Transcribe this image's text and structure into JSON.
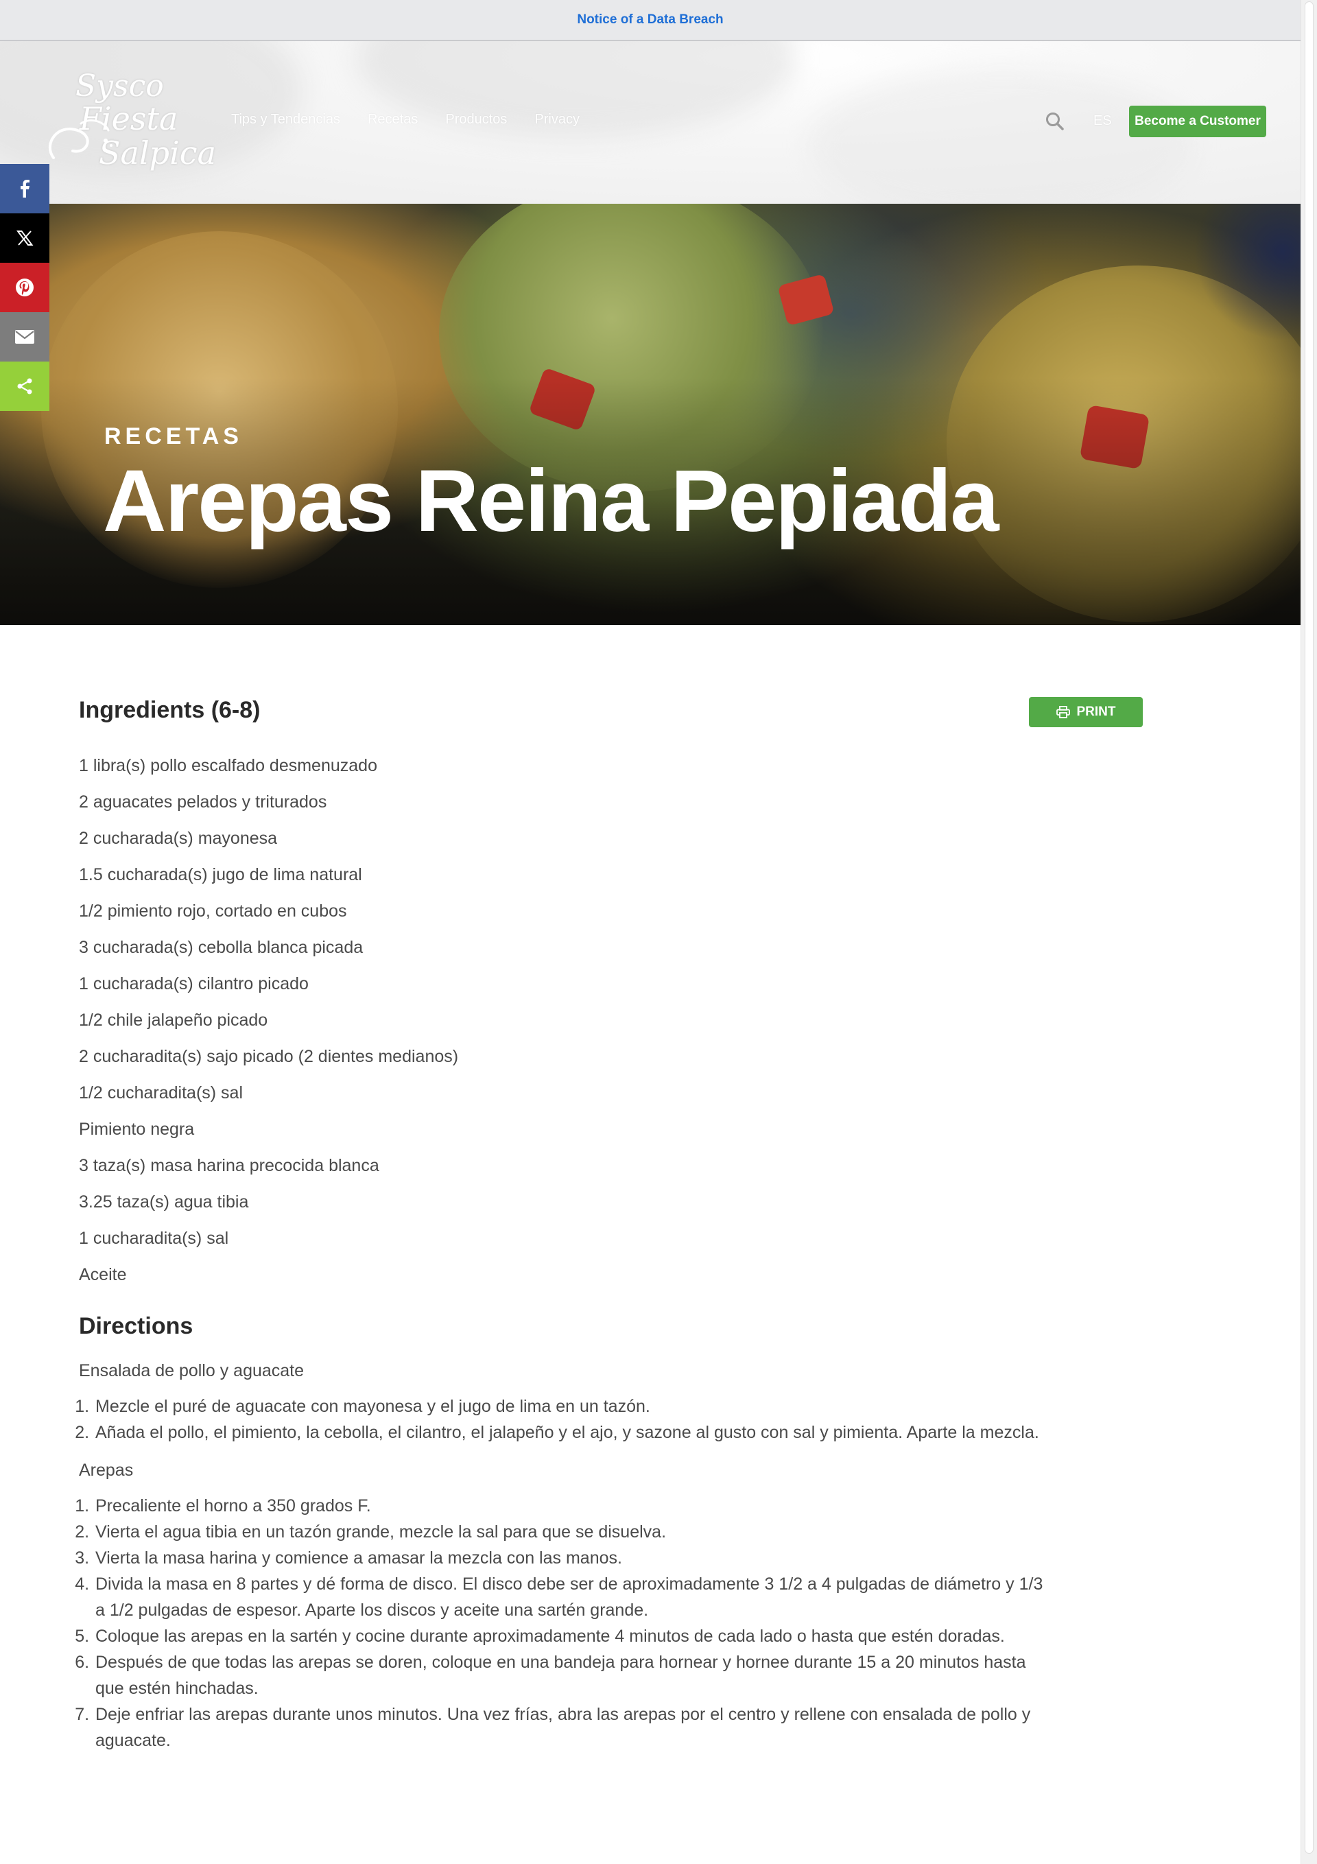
{
  "notice": {
    "link_label": "Notice of a Data Breach"
  },
  "brand": {
    "logo_line1": "Sysco",
    "logo_line2": "Fiesta",
    "logo_line3": "Salpica",
    "accent_color": "#53aa47",
    "link_color": "#1f6fd6"
  },
  "nav": {
    "items": [
      {
        "label": "Tips y Tendencias"
      },
      {
        "label": "Recetas"
      },
      {
        "label": "Productos"
      },
      {
        "label": "Privacy"
      }
    ],
    "search_icon": "search-icon",
    "language": "ES",
    "cta_label": "Become a Customer"
  },
  "share": {
    "buttons": [
      {
        "icon": "facebook-icon",
        "color": "#3b5998"
      },
      {
        "icon": "x-icon",
        "color": "#000000"
      },
      {
        "icon": "pinterest-icon",
        "color": "#cb2027"
      },
      {
        "icon": "email-icon",
        "color": "#7d7d7d"
      },
      {
        "icon": "share-icon",
        "color": "#95d03a"
      }
    ]
  },
  "hero": {
    "kicker": "RECETAS",
    "title": "Arepas Reina Pepiada"
  },
  "recipe": {
    "ingredients_title": "Ingredients (6-8)",
    "print_label": "PRINT",
    "ingredients": [
      "1 libra(s) pollo escalfado desmenuzado",
      "2 aguacates pelados y triturados",
      "2 cucharada(s) mayonesa",
      "1.5 cucharada(s) jugo de lima natural",
      "1/2 pimiento rojo, cortado en cubos",
      "3 cucharada(s) cebolla blanca picada",
      "1 cucharada(s) cilantro picado",
      "1/2 chile jalapeño picado",
      "2 cucharadita(s) sajo picado (2 dientes medianos)",
      "1/2 cucharadita(s) sal",
      "Pimiento negra",
      "3 taza(s) masa harina precocida blanca",
      "3.25 taza(s) agua tibia",
      "1 cucharadita(s) sal",
      "Aceite"
    ],
    "directions_title": "Directions",
    "sections": [
      {
        "title": "Ensalada de pollo y aguacate",
        "steps": [
          "Mezcle el puré de aguacate con mayonesa y el jugo de lima en un tazón.",
          "Añada el pollo, el pimiento, la cebolla, el cilantro, el jalapeño y el ajo, y sazone al gusto con sal y pimienta.  Aparte la mezcla."
        ]
      },
      {
        "title": "Arepas",
        "steps": [
          "Precaliente el horno a 350 grados F.",
          "Vierta el agua tibia en un tazón grande, mezcle la sal para que se disuelva.",
          "Vierta la masa harina y comience a amasar la mezcla con las manos.",
          "Divida la masa en 8 partes y dé forma de disco.  El disco debe ser de aproximadamente 3 1/2 a 4 pulgadas de diámetro y 1/3 a 1/2 pulgadas de espesor.  Aparte los discos y aceite una sartén grande.",
          "Coloque las arepas en la sartén y cocine durante aproximadamente 4 minutos de cada lado o hasta que estén doradas.",
          "Después de que todas las arepas se doren, coloque en una bandeja para hornear y hornee durante 15 a 20 minutos hasta que estén hinchadas.",
          "Deje enfriar las arepas durante unos minutos.  Una vez frías, abra las arepas por el centro y rellene con ensalada de pollo y aguacate."
        ]
      }
    ]
  }
}
